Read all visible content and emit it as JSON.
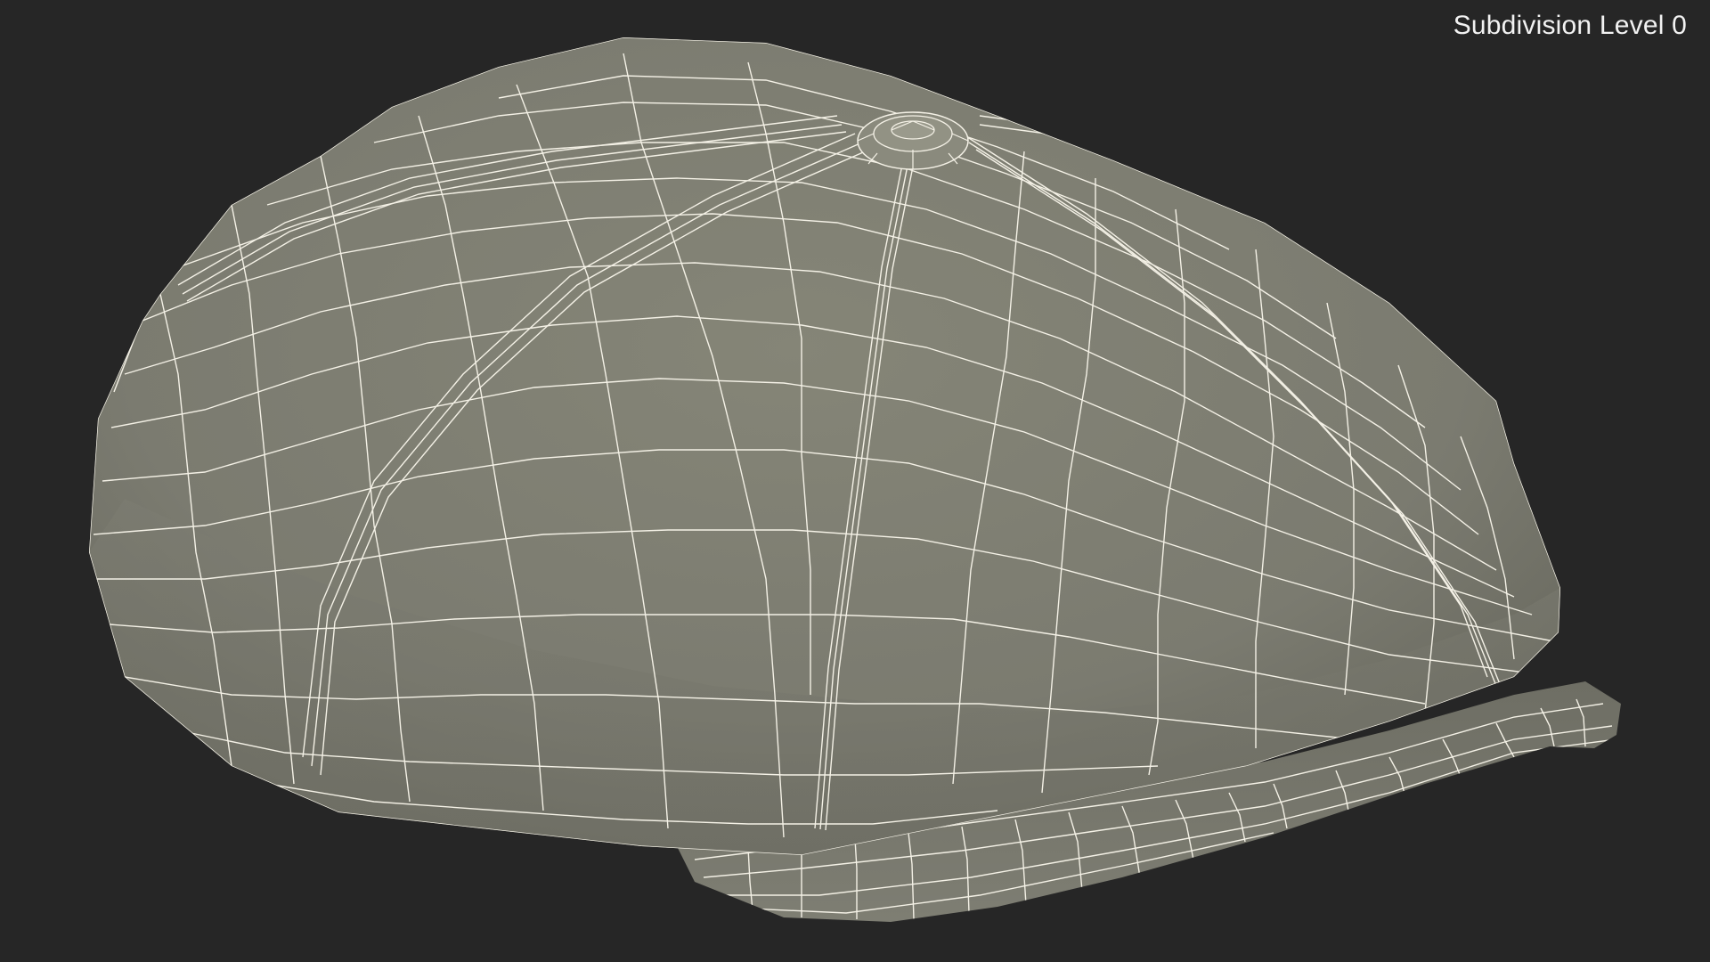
{
  "viewport": {
    "label": "Subdivision Level 0",
    "background_color": "#262626"
  },
  "model": {
    "subject": "newsboy-cap",
    "surface_color": "#7b7b70",
    "wire_color": "#f4f1e6"
  }
}
